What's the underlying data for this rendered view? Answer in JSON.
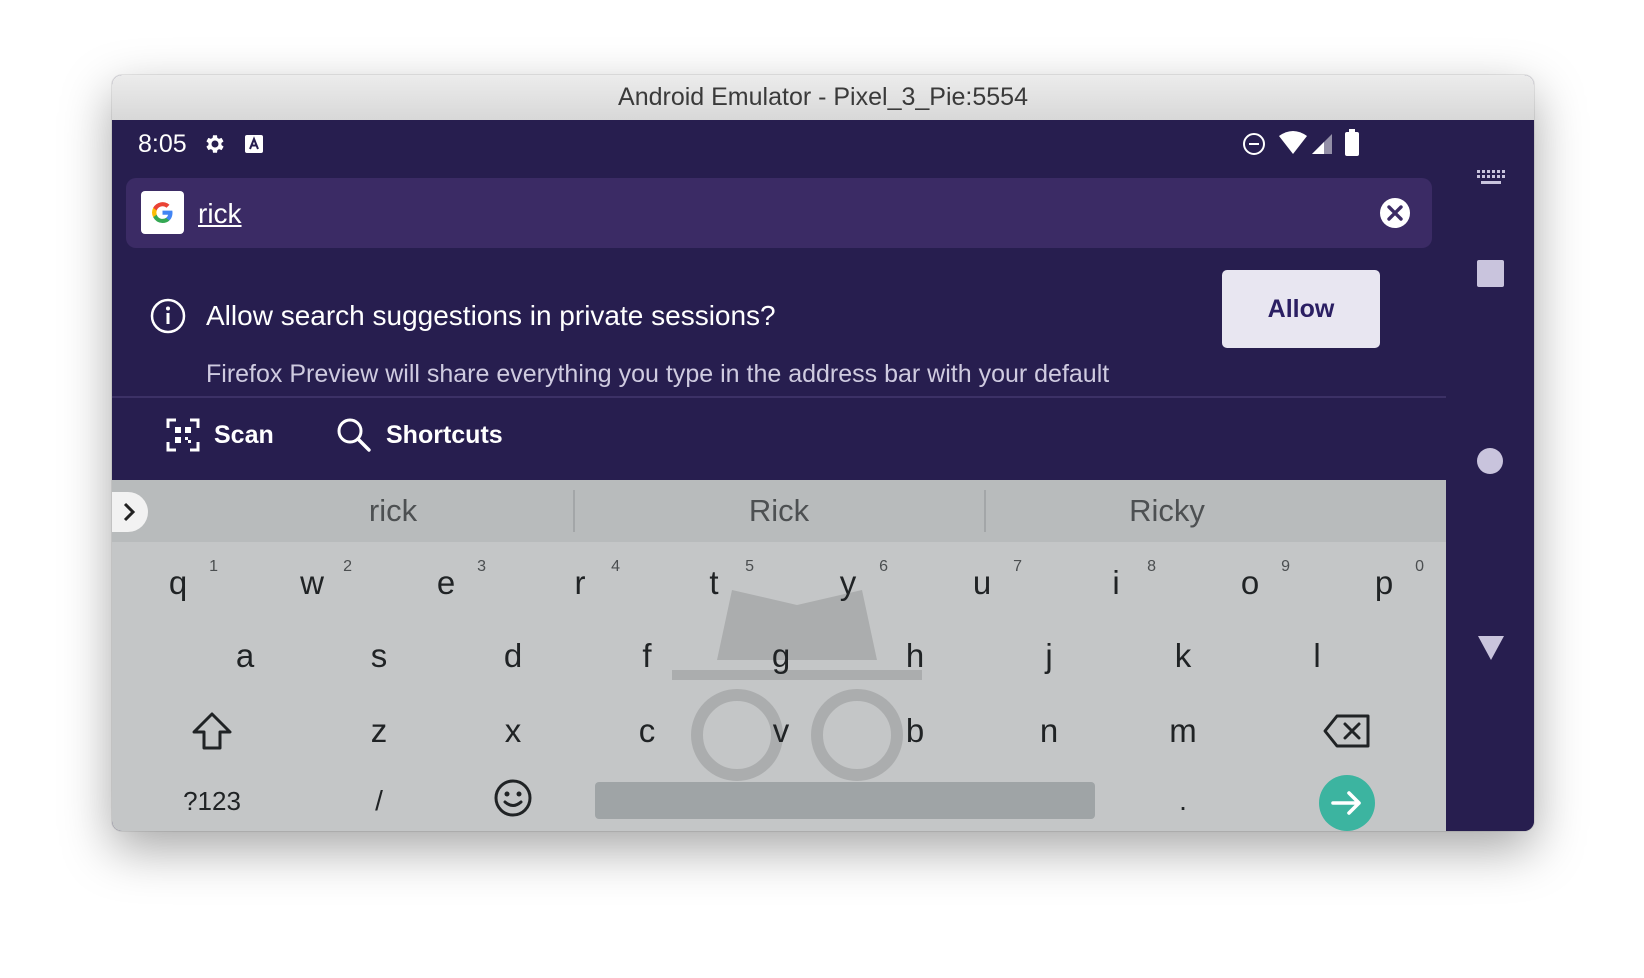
{
  "window": {
    "title": "Android Emulator - Pixel_3_Pie:5554"
  },
  "status_bar": {
    "time": "8:05",
    "icons": [
      "settings-icon",
      "keyboard-a-icon",
      "do-not-disturb-icon",
      "wifi-icon",
      "signal-icon",
      "battery-icon"
    ]
  },
  "url_bar": {
    "search_engine_icon": "google-icon",
    "query": "rick",
    "clear_icon": "close-circle-icon"
  },
  "suggestion_prompt": {
    "title": "Allow search suggestions in private sessions?",
    "description": "Firefox Preview will share everything you type in the address bar with your default",
    "allow_label": "Allow"
  },
  "toolbar": {
    "scan_label": "Scan",
    "shortcuts_label": "Shortcuts"
  },
  "keyboard": {
    "suggestions": [
      "rick",
      "Rick",
      "Ricky"
    ],
    "row1": [
      {
        "key": "q",
        "hint": "1"
      },
      {
        "key": "w",
        "hint": "2"
      },
      {
        "key": "e",
        "hint": "3"
      },
      {
        "key": "r",
        "hint": "4"
      },
      {
        "key": "t",
        "hint": "5"
      },
      {
        "key": "y",
        "hint": "6"
      },
      {
        "key": "u",
        "hint": "7"
      },
      {
        "key": "i",
        "hint": "8"
      },
      {
        "key": "o",
        "hint": "9"
      },
      {
        "key": "p",
        "hint": "0"
      }
    ],
    "row2": [
      "a",
      "s",
      "d",
      "f",
      "g",
      "h",
      "j",
      "k",
      "l"
    ],
    "row3": [
      "z",
      "x",
      "c",
      "v",
      "b",
      "n",
      "m"
    ],
    "row4": {
      "symbols": "?123",
      "slash": "/",
      "period": "."
    }
  },
  "colors": {
    "background": "#271e4f",
    "url_bar": "#3b2b65",
    "enter_key": "#3cb4a0",
    "keyboard": "#c4c6c7"
  }
}
